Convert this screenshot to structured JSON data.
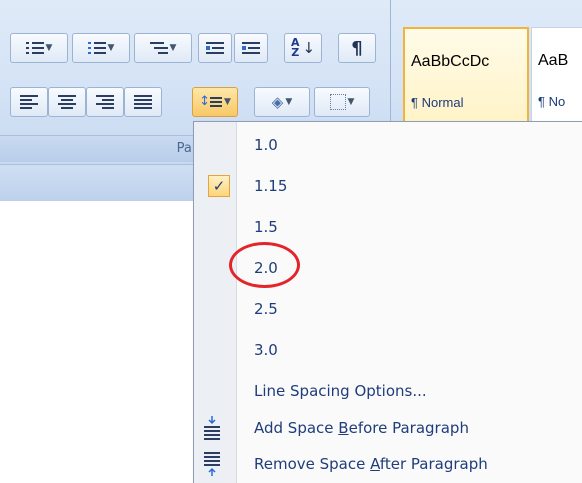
{
  "ribbon": {
    "group_label": "Parag",
    "styles": [
      {
        "sample": "AaBbCcDc",
        "name": "¶ Normal"
      },
      {
        "sample": "AaB",
        "name": "¶ No"
      }
    ]
  },
  "line_spacing_menu": {
    "items": [
      {
        "label": "1.0",
        "checked": false
      },
      {
        "label": "1.15",
        "checked": true
      },
      {
        "label": "1.5",
        "checked": false
      },
      {
        "label": "2.0",
        "checked": false,
        "circled": true
      },
      {
        "label": "2.5",
        "checked": false
      },
      {
        "label": "3.0",
        "checked": false
      }
    ],
    "options_label": "Line Spacing Options...",
    "add_before": {
      "pre": "Add Space ",
      "accel": "B",
      "post": "efore Paragraph"
    },
    "remove_after": {
      "pre": "Remove Space ",
      "accel": "A",
      "post": "fter Paragraph"
    },
    "check_glyph": "✓"
  },
  "colors": {
    "accent": "#f0b43a",
    "circle": "#e3252b",
    "menu_text": "#1f3d7a"
  }
}
